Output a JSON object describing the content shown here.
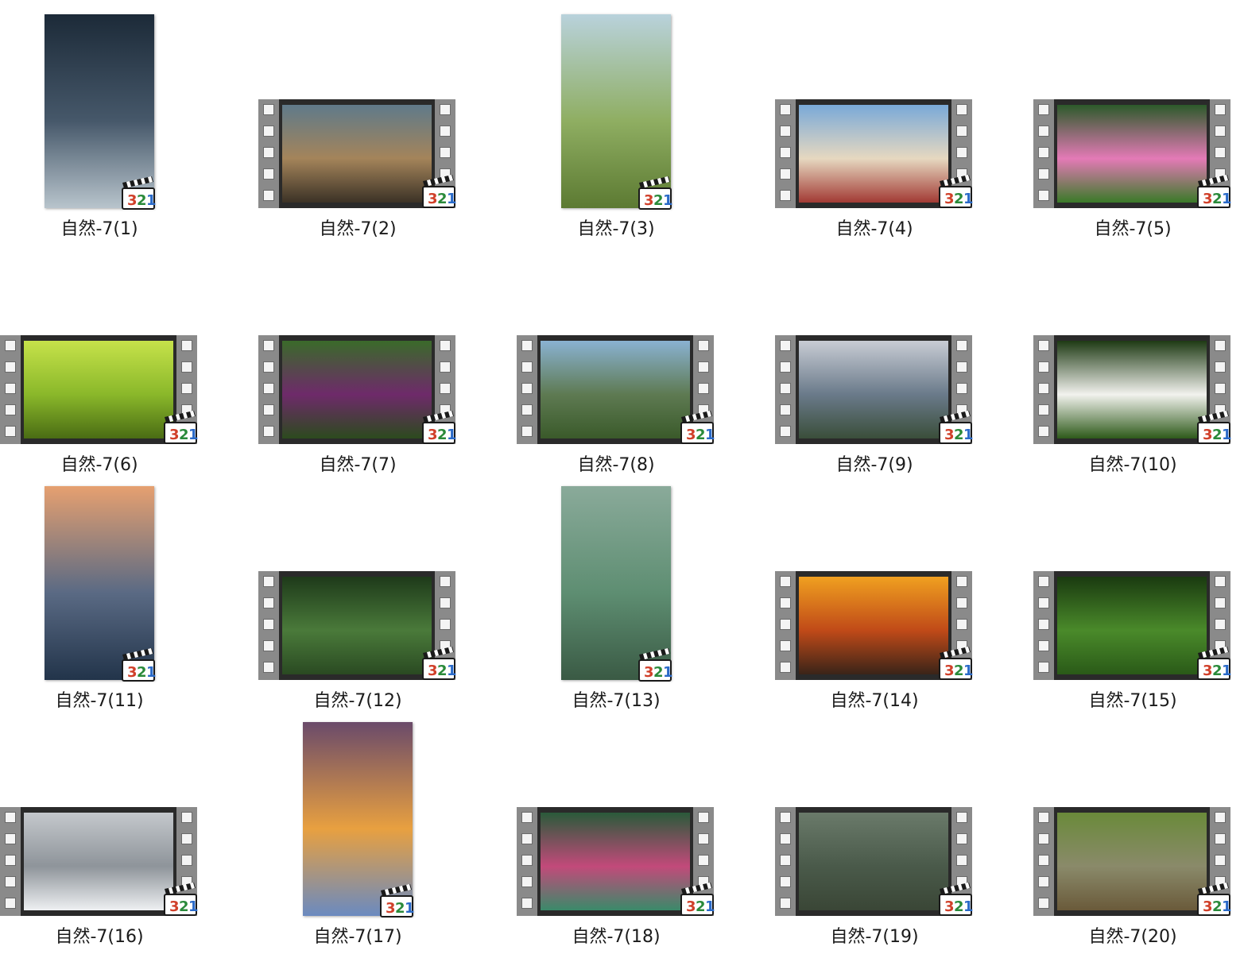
{
  "files": [
    {
      "name": "自然-7(1)",
      "layout": "portrait",
      "colors": [
        "#1c2a38",
        "#46586a",
        "#b8c4cc"
      ]
    },
    {
      "name": "自然-7(2)",
      "layout": "landscape",
      "colors": [
        "#5f7a8a",
        "#a4845a",
        "#3b3226"
      ]
    },
    {
      "name": "自然-7(3)",
      "layout": "portrait",
      "colors": [
        "#b9d2dc",
        "#8fae62",
        "#5c7a32"
      ]
    },
    {
      "name": "自然-7(4)",
      "layout": "landscape",
      "colors": [
        "#79a9d8",
        "#e6d8c0",
        "#a23a34"
      ]
    },
    {
      "name": "自然-7(5)",
      "layout": "landscape",
      "colors": [
        "#2c5a2a",
        "#e47ab6",
        "#3a7a28"
      ]
    },
    {
      "name": "自然-7(6)",
      "layout": "landscape",
      "colors": [
        "#c6e24a",
        "#8ab82a",
        "#4a6c14"
      ]
    },
    {
      "name": "自然-7(7)",
      "layout": "landscape",
      "colors": [
        "#3a6a2a",
        "#6e2a6a",
        "#2c4a1e"
      ]
    },
    {
      "name": "自然-7(8)",
      "layout": "landscape",
      "colors": [
        "#8ab2d2",
        "#5e7a52",
        "#3a5a2a"
      ]
    },
    {
      "name": "自然-7(9)",
      "layout": "landscape",
      "colors": [
        "#c8ccd4",
        "#6a7a8a",
        "#3a4e3a"
      ]
    },
    {
      "name": "自然-7(10)",
      "layout": "landscape",
      "colors": [
        "#1e3a14",
        "#f2f2ee",
        "#2e5a1a"
      ]
    },
    {
      "name": "自然-7(11)",
      "layout": "portrait",
      "colors": [
        "#e6a070",
        "#5a6a84",
        "#22344a"
      ]
    },
    {
      "name": "自然-7(12)",
      "layout": "landscape",
      "colors": [
        "#1e3a1a",
        "#4a7a3a",
        "#2a4a22"
      ]
    },
    {
      "name": "自然-7(13)",
      "layout": "portrait",
      "colors": [
        "#8aaa9a",
        "#5e8e72",
        "#3a5a44"
      ]
    },
    {
      "name": "自然-7(14)",
      "layout": "landscape",
      "colors": [
        "#f0a020",
        "#c04a18",
        "#3a2418"
      ]
    },
    {
      "name": "自然-7(15)",
      "layout": "landscape",
      "colors": [
        "#1a3a10",
        "#4a8a2a",
        "#2a5a18"
      ]
    },
    {
      "name": "自然-7(16)",
      "layout": "landscape",
      "colors": [
        "#c4c8cc",
        "#8e949a",
        "#eef0f2"
      ]
    },
    {
      "name": "自然-7(17)",
      "layout": "portrait",
      "colors": [
        "#6a4a6a",
        "#e8a040",
        "#6a8ac0"
      ]
    },
    {
      "name": "自然-7(18)",
      "layout": "landscape",
      "colors": [
        "#2a5a3a",
        "#c24a7a",
        "#3a8a6a"
      ]
    },
    {
      "name": "自然-7(19)",
      "layout": "landscape",
      "colors": [
        "#6a7a6a",
        "#4a5a4a",
        "#3a4636"
      ]
    },
    {
      "name": "自然-7(20)",
      "layout": "landscape",
      "colors": [
        "#6a8a3a",
        "#8a8a6a",
        "#6a5a3a"
      ]
    }
  ],
  "badge_icon": "media-player-classic-321-icon",
  "badge_text": "321",
  "badge_colors": {
    "three": "#d0402a",
    "two": "#2a8a3a",
    "one": "#2a6ac8"
  }
}
